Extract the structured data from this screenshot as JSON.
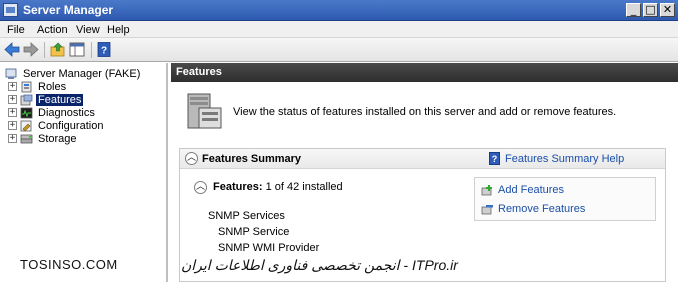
{
  "window": {
    "title": "Server Manager",
    "buttons": {
      "minimize": "_",
      "maximize": "□",
      "close": "✕"
    }
  },
  "menu": {
    "items": [
      "File",
      "Action",
      "View",
      "Help"
    ]
  },
  "toolbar": {
    "icons": [
      "back-arrow-icon",
      "forward-arrow-icon",
      "up-folder-icon",
      "show-hide-tree-icon",
      "help-icon"
    ]
  },
  "tree": {
    "root": "Server Manager (FAKE)",
    "items": [
      {
        "label": "Roles",
        "icon": "roles-icon",
        "selected": false
      },
      {
        "label": "Features",
        "icon": "features-icon",
        "selected": true
      },
      {
        "label": "Diagnostics",
        "icon": "diagnostics-icon",
        "selected": false
      },
      {
        "label": "Configuration",
        "icon": "configuration-icon",
        "selected": false
      },
      {
        "label": "Storage",
        "icon": "storage-icon",
        "selected": false
      }
    ]
  },
  "content": {
    "header": "Features",
    "intro": "View the status of features installed on this server and add or remove features.",
    "summary": {
      "title": "Features Summary",
      "help_link": "Features Summary Help",
      "help_icon_glyph": "?",
      "features_label": "Features:",
      "features_count": "1 of 42 installed",
      "installed": [
        "SNMP Services",
        "SNMP Service",
        "SNMP WMI Provider"
      ],
      "tasks": [
        "Add Features",
        "Remove Features"
      ]
    }
  },
  "watermarks": {
    "left": "TOSINSO.COM",
    "right": "ITPro.ir - انجمن تخصصی فناوری اطلاعات ایران"
  },
  "colors": {
    "selection": "#0a246a",
    "link": "#1a4fa8",
    "header_dark": "#3a3a3a",
    "titlebar": "#3a68be"
  }
}
